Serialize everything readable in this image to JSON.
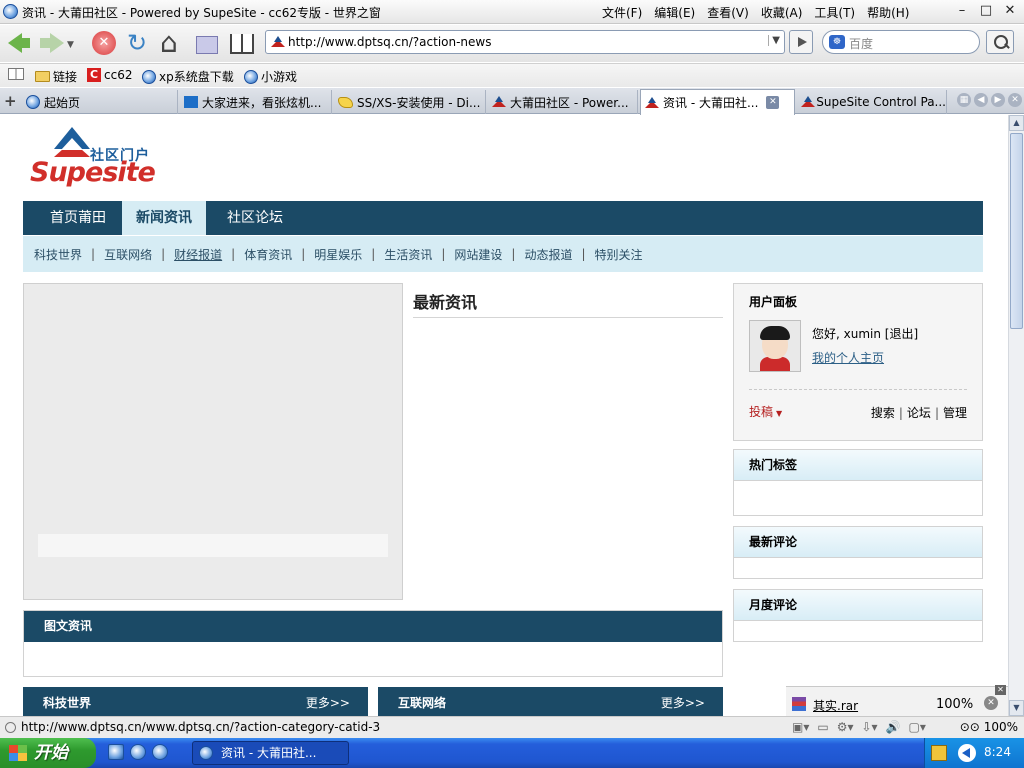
{
  "window": {
    "title": "资讯 - 大莆田社区 - Powered by SupeSite - cc62专版 - 世界之窗",
    "menu": [
      "文件(F)",
      "编辑(E)",
      "查看(V)",
      "收藏(A)",
      "工具(T)",
      "帮助(H)"
    ],
    "controls": [
      "–",
      "□",
      "✕"
    ]
  },
  "navbar": {
    "url": "http://www.dptsq.cn/?action-news",
    "search_placeholder": "百度"
  },
  "bookmarks": [
    "链接",
    "cc62",
    "xp系统盘下载",
    "小游戏"
  ],
  "tabs": [
    {
      "label": "起始页",
      "active": false
    },
    {
      "label": "大家进来，看张炫机...",
      "active": false
    },
    {
      "label": "SS/XS-安装使用 - Di...",
      "active": false
    },
    {
      "label": "大莆田社区 - Power...",
      "active": false
    },
    {
      "label": "资讯 - 大莆田社...",
      "active": true
    },
    {
      "label": "SupeSite Control Pa...",
      "active": false
    }
  ],
  "site": {
    "logo_sub": "社区门户",
    "logo_brand_a": "Supe",
    "logo_brand_b": "site",
    "main_nav": [
      {
        "label": "首页莆田",
        "active": false
      },
      {
        "label": "新闻资讯",
        "active": true
      },
      {
        "label": "社区论坛",
        "active": false
      }
    ],
    "sub_nav": [
      "科技世界",
      "互联网络",
      "财经报道",
      "体育资讯",
      "明星娱乐",
      "生活资讯",
      "网站建设",
      "动态报道",
      "特别关注"
    ],
    "sub_nav_separator": "|",
    "latest_title": "最新资讯",
    "user_panel": {
      "title": "用户面板",
      "hello": "您好, xumin [退出]",
      "homepage_link": "我的个人主页",
      "submit": "投稿",
      "links": [
        "搜索",
        "论坛",
        "管理"
      ]
    },
    "hot_tags": "热门标签",
    "latest_comments": "最新评论",
    "monthly_comments": "月度评论",
    "image_news": "图文资讯",
    "category_boxes": [
      {
        "title": "科技世界",
        "more": "更多>>"
      },
      {
        "title": "互联网络",
        "more": "更多>>"
      }
    ]
  },
  "download": {
    "filename": "其实.rar",
    "percent": "100%"
  },
  "statusbar": {
    "text": "http://www.dptsq.cn/www.dptsq.cn/?action-category-catid-3",
    "zoom": "100%"
  },
  "taskbar": {
    "start": "开始",
    "task": "资讯 - 大莆田社...",
    "clock": "8:24"
  },
  "colors": {
    "nav_dark": "#1b4a66",
    "nav_light": "#d6ecf4",
    "brand_red": "#d12f2a",
    "brand_blue": "#1d5e9c"
  }
}
